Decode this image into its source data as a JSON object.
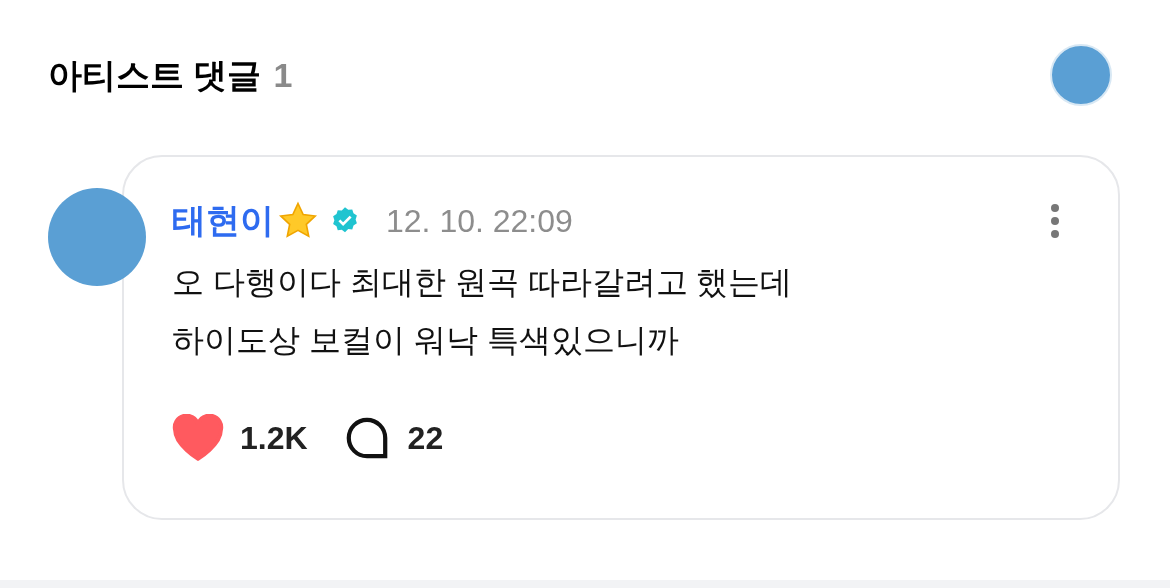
{
  "header": {
    "title": "아티스트 댓글",
    "count": "1"
  },
  "comment": {
    "author": "태현이",
    "verified": true,
    "time": "12. 10. 22:09",
    "lines": [
      "오 다행이다 최대한 원곡 따라갈려고 했는데",
      "하이도상 보컬이 워낙 특색있으니까"
    ],
    "liked": true,
    "likes": "1.2K",
    "replies": "22"
  }
}
